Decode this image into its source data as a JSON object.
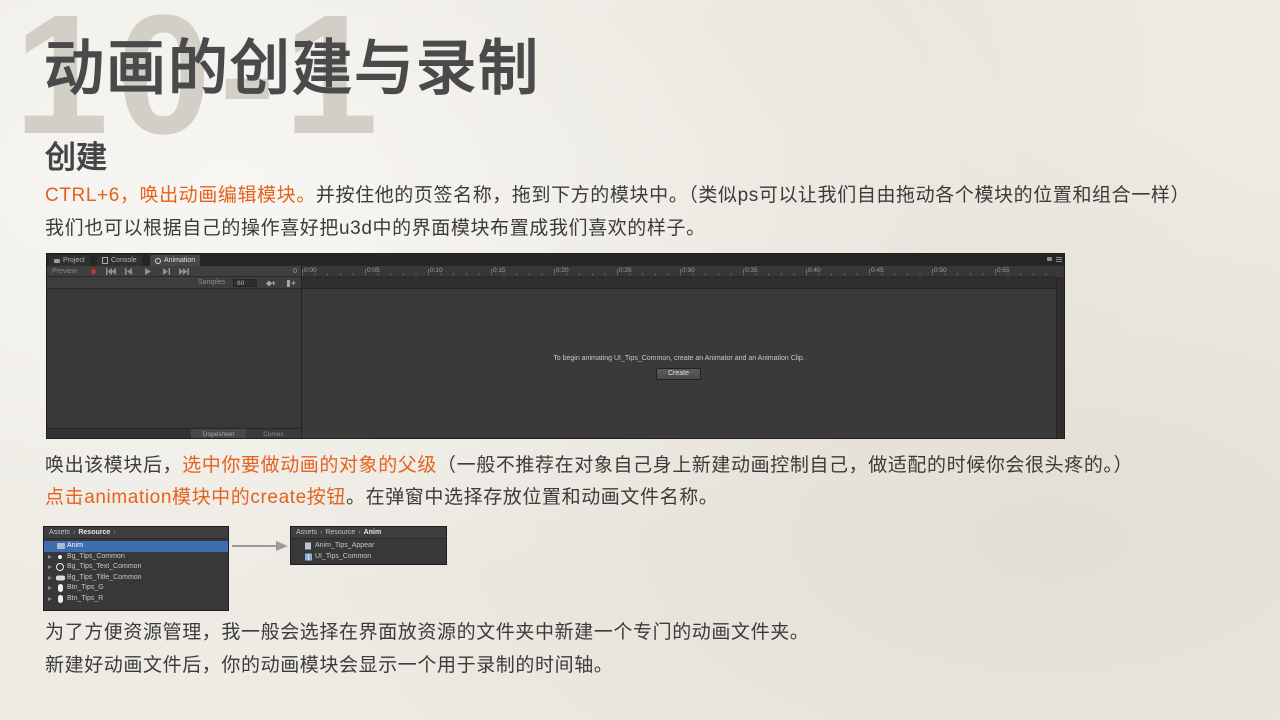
{
  "slide": {
    "watermark": "10-1",
    "title": "动画的创建与录制",
    "section_heading": "创建",
    "colors": {
      "accent": "#e5621c",
      "body_text": "#3b3b3b",
      "title": "#4a4a4a",
      "watermark": "#cdc9c1",
      "background": "#eeebe4"
    }
  },
  "text": {
    "line1": {
      "highlight": "CTRL+6，唤出动画编辑模块。",
      "rest": "并按住他的页签名称，拖到下方的模块中。（类似ps可以让我们自由拖动各个模块的位置和组合一样）"
    },
    "line2": "我们也可以根据自己的操作喜好把u3d中的界面模块布置成我们喜欢的样子。",
    "line3": {
      "before": "唤出该模块后，",
      "highlight": "选中你要做动画的对象的父级",
      "after": "（一般不推荐在对象自己身上新建动画控制自己，做适配的时候你会很头疼的。）"
    },
    "line4": {
      "highlight": "点击animation模块中的create按钮",
      "after": "。在弹窗中选择存放位置和动画文件名称。"
    },
    "line5": "为了方便资源管理，我一般会选择在界面放资源的文件夹中新建一个专门的动画文件夹。",
    "line6": "新建好动画文件后，你的动画模块会显示一个用于录制的时间轴。"
  },
  "animation_window": {
    "tabs": [
      {
        "label": "Project",
        "icon": "folder-icon",
        "active": false
      },
      {
        "label": "Console",
        "icon": "console-icon",
        "active": false
      },
      {
        "label": "Animation",
        "icon": "animation-icon",
        "active": true
      }
    ],
    "preview_label": "Preview",
    "frame_value": "0",
    "ruler_ticks": [
      "0:00",
      "0:05",
      "0:10",
      "0:15",
      "0:20",
      "0:25",
      "0:30",
      "0:35",
      "0:40",
      "0:45",
      "0:50",
      "0:55"
    ],
    "samples_label": "Samples",
    "samples_value": "60",
    "message": "To begin animating UI_Tips_Common, create an Animator and an Animation Clip.",
    "create_button": "Create",
    "bottom_tabs": [
      {
        "label": "Dopesheet",
        "active": true
      },
      {
        "label": "Curves",
        "active": false
      }
    ],
    "colors": {
      "record": "#c0392b",
      "selection": "#3e6db0"
    }
  },
  "project_before": {
    "breadcrumb": [
      "Assets",
      "Resource"
    ],
    "items": [
      {
        "label": "Anim",
        "icon": "folder-icon",
        "selected": true
      },
      {
        "label": "Bg_Tips_Common",
        "icon": "sprite-dot-icon"
      },
      {
        "label": "Bg_Tips_Text_Common",
        "icon": "sprite-ring-icon"
      },
      {
        "label": "Bg_Tips_Title_Common",
        "icon": "sprite-rounded-rect-icon"
      },
      {
        "label": "Btn_Tips_G",
        "icon": "sprite-pill-icon"
      },
      {
        "label": "Btn_Tips_R",
        "icon": "sprite-pill-icon"
      }
    ]
  },
  "project_after": {
    "breadcrumb": [
      "Assets",
      "Resource",
      "Anim"
    ],
    "items": [
      {
        "label": "Anim_Tips_Appear",
        "icon": "animation-clip-icon"
      },
      {
        "label": "UI_Tips_Common",
        "icon": "animator-controller-icon"
      }
    ]
  }
}
